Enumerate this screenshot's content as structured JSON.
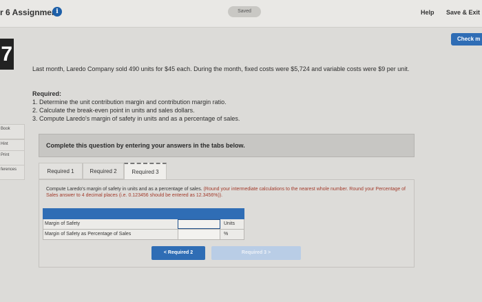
{
  "header": {
    "app_title": "r 6 Assignment",
    "info_icon": "i",
    "saved_label": "Saved",
    "help_label": "Help",
    "save_exit_label": "Save & Exit",
    "check_label": "Check m"
  },
  "question": {
    "number": "7",
    "body": "Last month, Laredo Company sold 490 units for $45 each. During the month, fixed costs were $5,724 and variable costs were $9 per unit.",
    "required_heading": "Required:",
    "required_items": [
      "1. Determine the unit contribution margin and contribution margin ratio.",
      "2. Calculate the break-even point in units and sales dollars.",
      "3. Compute Laredo's margin of safety in units and as a percentage of sales."
    ]
  },
  "left_nav": {
    "items": [
      "Book",
      "Hint",
      "Print",
      "ferences"
    ]
  },
  "instructions_bar": "Complete this question by entering your answers in the tabs below.",
  "tabs": [
    {
      "label": "Required 1"
    },
    {
      "label": "Required 2"
    },
    {
      "label": "Required 3"
    }
  ],
  "panel": {
    "instruction_main": "Compute Laredo's margin of safety in units and as a percentage of sales.",
    "instruction_note": "(Round your intermediate calculations to the nearest whole number. Round your Percentage of Sales answer to 4 decimal places (i.e. 0.123456 should be entered as 12.3456%)).",
    "rows": [
      {
        "label": "Margin of Safety",
        "value": "",
        "unit": "Units"
      },
      {
        "label": "Margin of Safety as Percentage of Sales",
        "value": "",
        "unit": "%"
      }
    ],
    "prev_button": "<  Required 2",
    "next_button": "Required 3  >"
  },
  "colors": {
    "accent": "#2f6db5",
    "note": "#a23a2a"
  }
}
